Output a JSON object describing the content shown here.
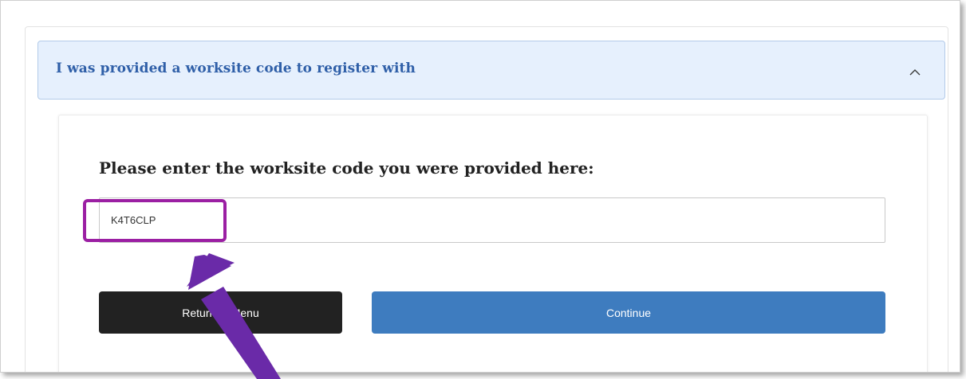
{
  "accordion": {
    "title": "I was provided a worksite code to register with",
    "expanded": true,
    "chevron_icon": "chevron-up-icon"
  },
  "form": {
    "prompt": "Please enter the worksite code you were provided here:",
    "code_value": "K4T6CLP",
    "return_button_label": "Return to Menu",
    "continue_button_label": "Continue"
  },
  "annotation": {
    "highlight_color": "#9b1fa3",
    "arrow_color": "#6a2aa8"
  },
  "colors": {
    "accent": "#3e7cbf",
    "header_bg": "#e6f0fd",
    "header_text": "#2f5fa8",
    "dark_button": "#222222"
  }
}
